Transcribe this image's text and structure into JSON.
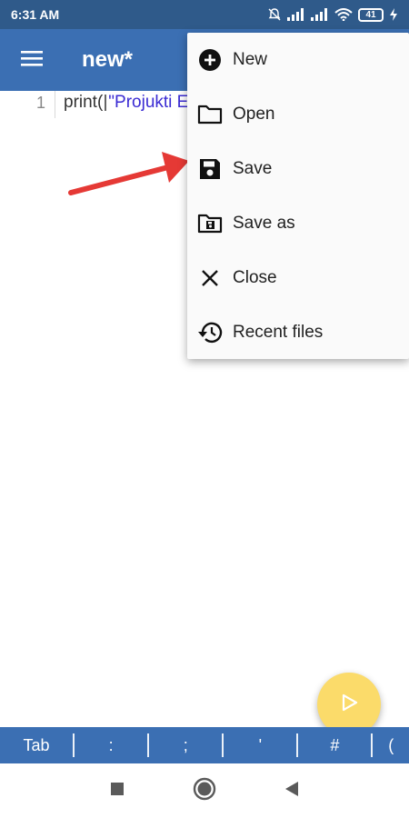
{
  "status_bar": {
    "time": "6:31 AM",
    "battery": "41"
  },
  "app_bar": {
    "title": "new*"
  },
  "editor": {
    "line_number": "1",
    "code_function": "print(",
    "code_string": "\"Projukti E"
  },
  "menu": {
    "items": [
      {
        "label": "New",
        "icon": "add-circle-icon"
      },
      {
        "label": "Open",
        "icon": "folder-icon"
      },
      {
        "label": "Save",
        "icon": "save-icon"
      },
      {
        "label": "Save as",
        "icon": "save-as-icon"
      },
      {
        "label": "Close",
        "icon": "close-icon"
      },
      {
        "label": "Recent files",
        "icon": "history-icon"
      }
    ]
  },
  "symbol_bar": {
    "keys": [
      "Tab",
      ":",
      ";",
      "'",
      "#",
      "("
    ]
  },
  "colors": {
    "app_bar": "#3b6fb3",
    "status_bar": "#2f5a8a",
    "fab": "#fbdb6a",
    "arrow": "#e53935"
  }
}
